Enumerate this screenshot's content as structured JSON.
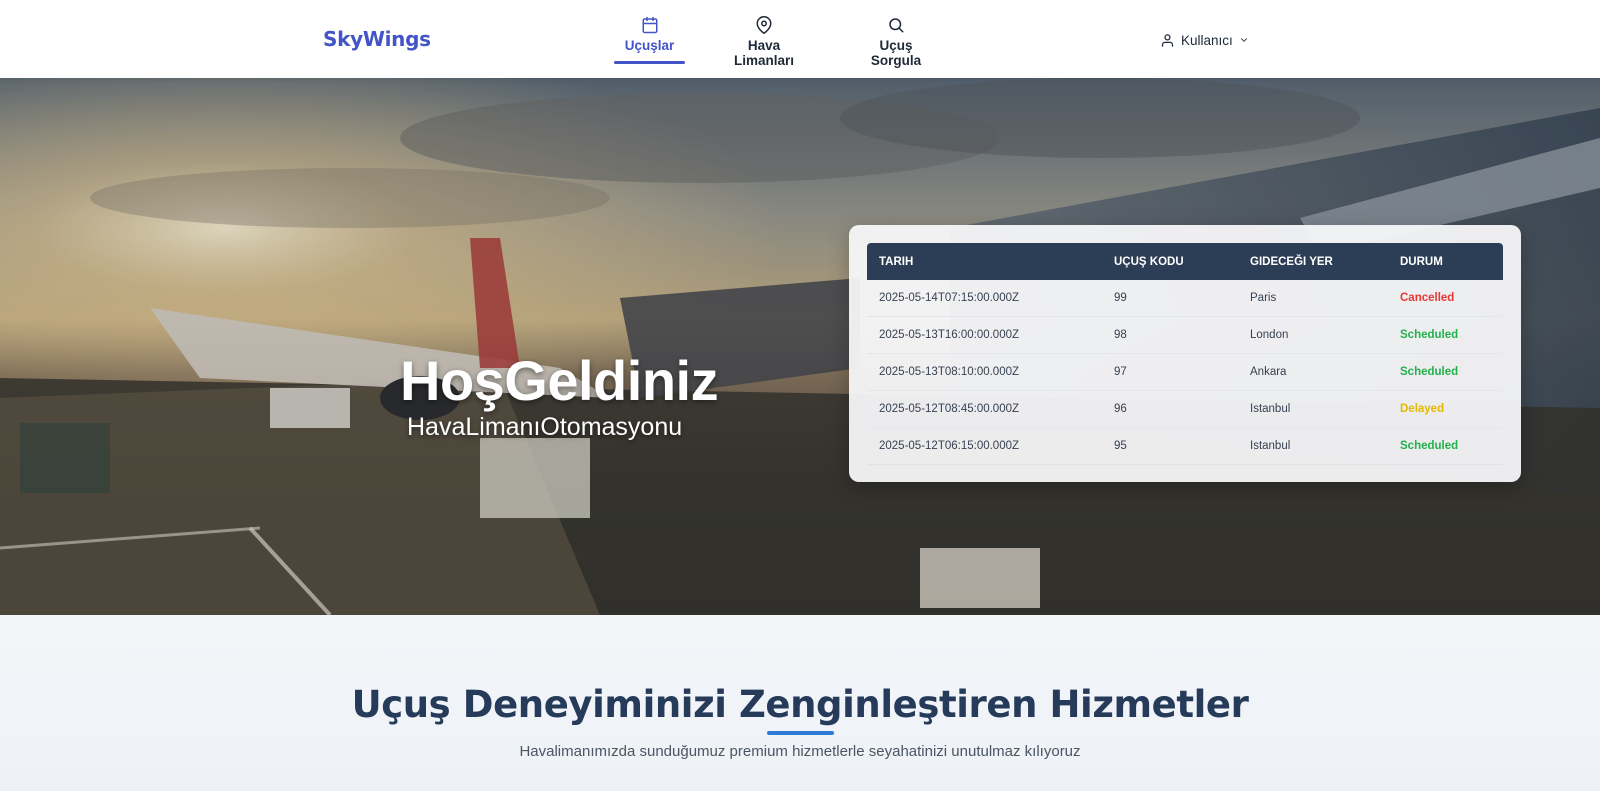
{
  "app": {
    "logo": "SkyWings"
  },
  "nav": {
    "items": [
      {
        "label": "Uçuşlar",
        "icon": "calendar-icon",
        "active": true
      },
      {
        "label": "Hava Limanları",
        "icon": "map-pin-icon",
        "active": false
      },
      {
        "label": "Uçuş Sorgula",
        "icon": "search-icon",
        "active": false
      }
    ]
  },
  "user": {
    "label": "Kullanıcı",
    "icon": "user-icon"
  },
  "hero": {
    "title": "HoşGeldiniz",
    "subtitle": "HavaLimanıOtomasyonu"
  },
  "flights": {
    "columns": [
      "TARIH",
      "UÇUŞ KODU",
      "GIDECEĞI YER",
      "DURUM"
    ],
    "rows": [
      {
        "date": "2025-05-14T07:15:00.000Z",
        "code": "99",
        "destination": "Paris",
        "status": "Cancelled"
      },
      {
        "date": "2025-05-13T16:00:00.000Z",
        "code": "98",
        "destination": "London",
        "status": "Scheduled"
      },
      {
        "date": "2025-05-13T08:10:00.000Z",
        "code": "97",
        "destination": "Ankara",
        "status": "Scheduled"
      },
      {
        "date": "2025-05-12T08:45:00.000Z",
        "code": "96",
        "destination": "Istanbul",
        "status": "Delayed"
      },
      {
        "date": "2025-05-12T06:15:00.000Z",
        "code": "95",
        "destination": "Istanbul",
        "status": "Scheduled"
      }
    ],
    "status_colors": {
      "Cancelled": "#e53935",
      "Scheduled": "#22b14c",
      "Delayed": "#e6b800"
    }
  },
  "services": {
    "title": "Uçuş Deneyiminizi Zenginleştiren Hizmetler",
    "description": "Havalimanımızda sunduğumuz premium hizmetlerle seyahatinizi unutulmaz kılıyoruz"
  },
  "colors": {
    "brand": "#4353c8",
    "table_header": "#2c3e55",
    "heading": "#263a59",
    "accent": "#2e7bd6"
  }
}
